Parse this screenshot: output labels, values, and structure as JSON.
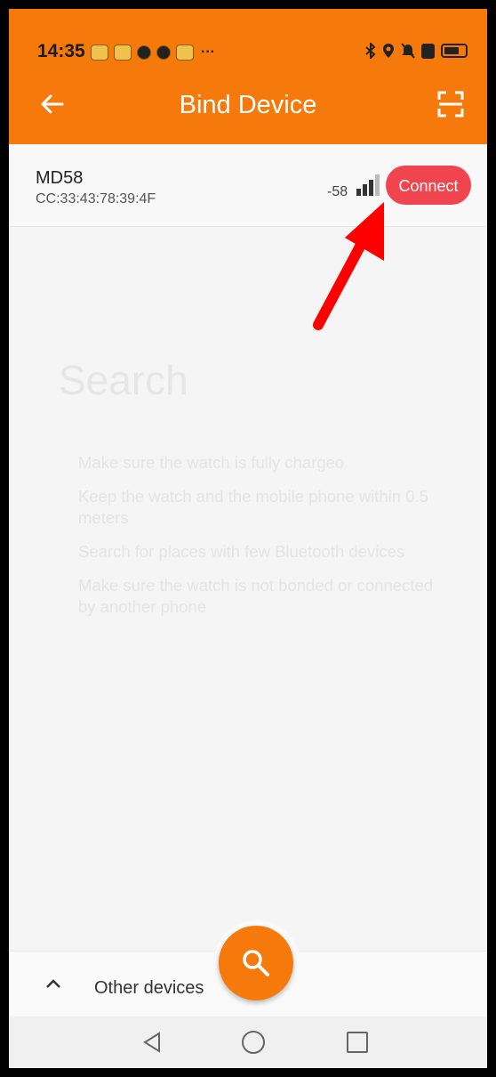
{
  "status_bar": {
    "time": "14:35",
    "more_indicator": "···",
    "notification_icons": [
      "weibo-icon",
      "weibo-icon",
      "shield-icon",
      "bell-icon",
      "weibo-icon"
    ],
    "system_icons": [
      "bluetooth-icon",
      "location-icon",
      "mute-icon",
      "nfc-icon",
      "battery-icon"
    ]
  },
  "app_bar": {
    "title": "Bind Device",
    "color": "#f67a0b"
  },
  "device": {
    "name": "MD58",
    "mac": "CC:33:43:78:39:4F",
    "rssi": "-58",
    "connect_label": "Connect",
    "connect_color": "#f0444e"
  },
  "search": {
    "title": "Search",
    "tips": [
      "Make sure the watch is fully chargeo",
      "Keep the watch and the mobile phone within 0.5 meters",
      "Search for places with few Bluetooth devices",
      "Make sure the watch is not bonded or connected by another phone"
    ]
  },
  "bottom": {
    "other_devices_label": "Other devices"
  },
  "annotation": {
    "arrow_color": "#ff0000"
  }
}
